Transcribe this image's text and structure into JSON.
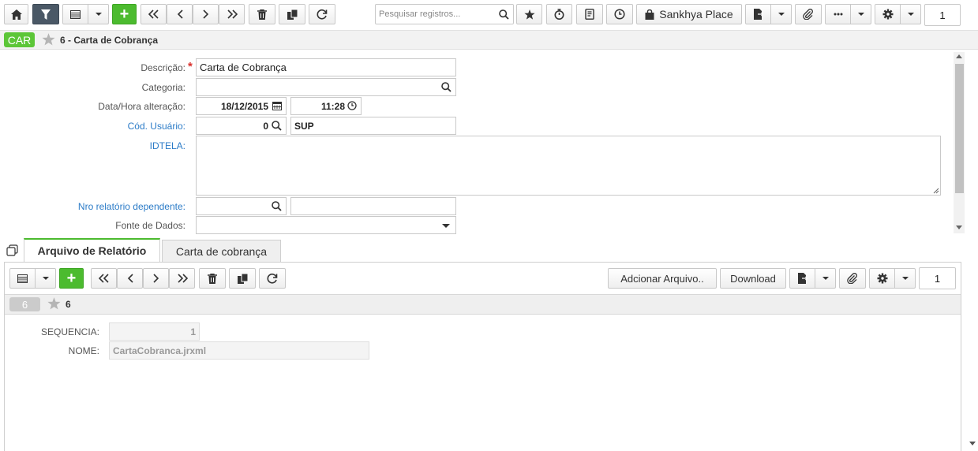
{
  "toolbar": {
    "search_placeholder": "Pesquisar registros...",
    "place_label": "Sankhya Place",
    "page_number": "1"
  },
  "header": {
    "badge": "CAR",
    "title": "6 - Carta de Cobrança"
  },
  "form": {
    "descricao_label": "Descrição:",
    "descricao_value": "Carta de Cobrança",
    "categoria_label": "Categoria:",
    "categoria_value": "",
    "data_label": "Data/Hora alteração:",
    "data_value": "18/12/2015",
    "hora_value": "11:28",
    "usuario_label": "Cód. Usuário:",
    "usuario_code": "0",
    "usuario_name": "SUP",
    "idtela_label": "IDTELA:",
    "nro_label": "Nro relatório dependente:",
    "fonte_label": "Fonte de Dados:"
  },
  "tabs": [
    {
      "label": "Arquivo de Relatório"
    },
    {
      "label": "Carta de cobrança"
    }
  ],
  "subtoolbar": {
    "adicionar_label": "Adcionar Arquivo..",
    "download_label": "Download",
    "page_number": "1"
  },
  "subheader": {
    "badge": "6",
    "title": "6"
  },
  "subform": {
    "sequencia_label": "SEQUENCIA:",
    "sequencia_value": "1",
    "nome_label": "NOME:",
    "nome_value": "CartaCobranca.jrxml"
  }
}
